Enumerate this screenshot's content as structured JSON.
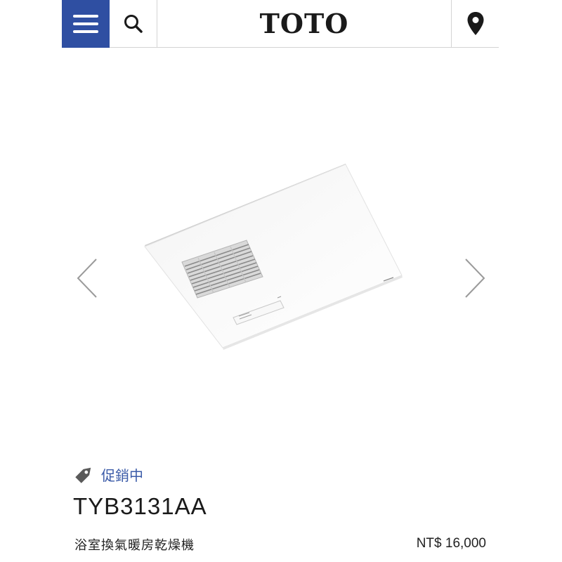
{
  "header": {
    "brand": "TOTO",
    "menu_icon": "hamburger-menu-icon",
    "search_icon": "search-icon",
    "location_icon": "map-pin-icon",
    "accent_color": "#2f4fa2"
  },
  "carousel": {
    "prev_icon": "chevron-left-icon",
    "next_icon": "chevron-right-icon"
  },
  "product": {
    "promo_icon": "tag-icon",
    "promo_label": "促銷中",
    "promo_color": "#3b5ba8",
    "model": "TYB3131AA",
    "name": "浴室換氣暖房乾燥機",
    "price": "NT$ 16,000"
  }
}
